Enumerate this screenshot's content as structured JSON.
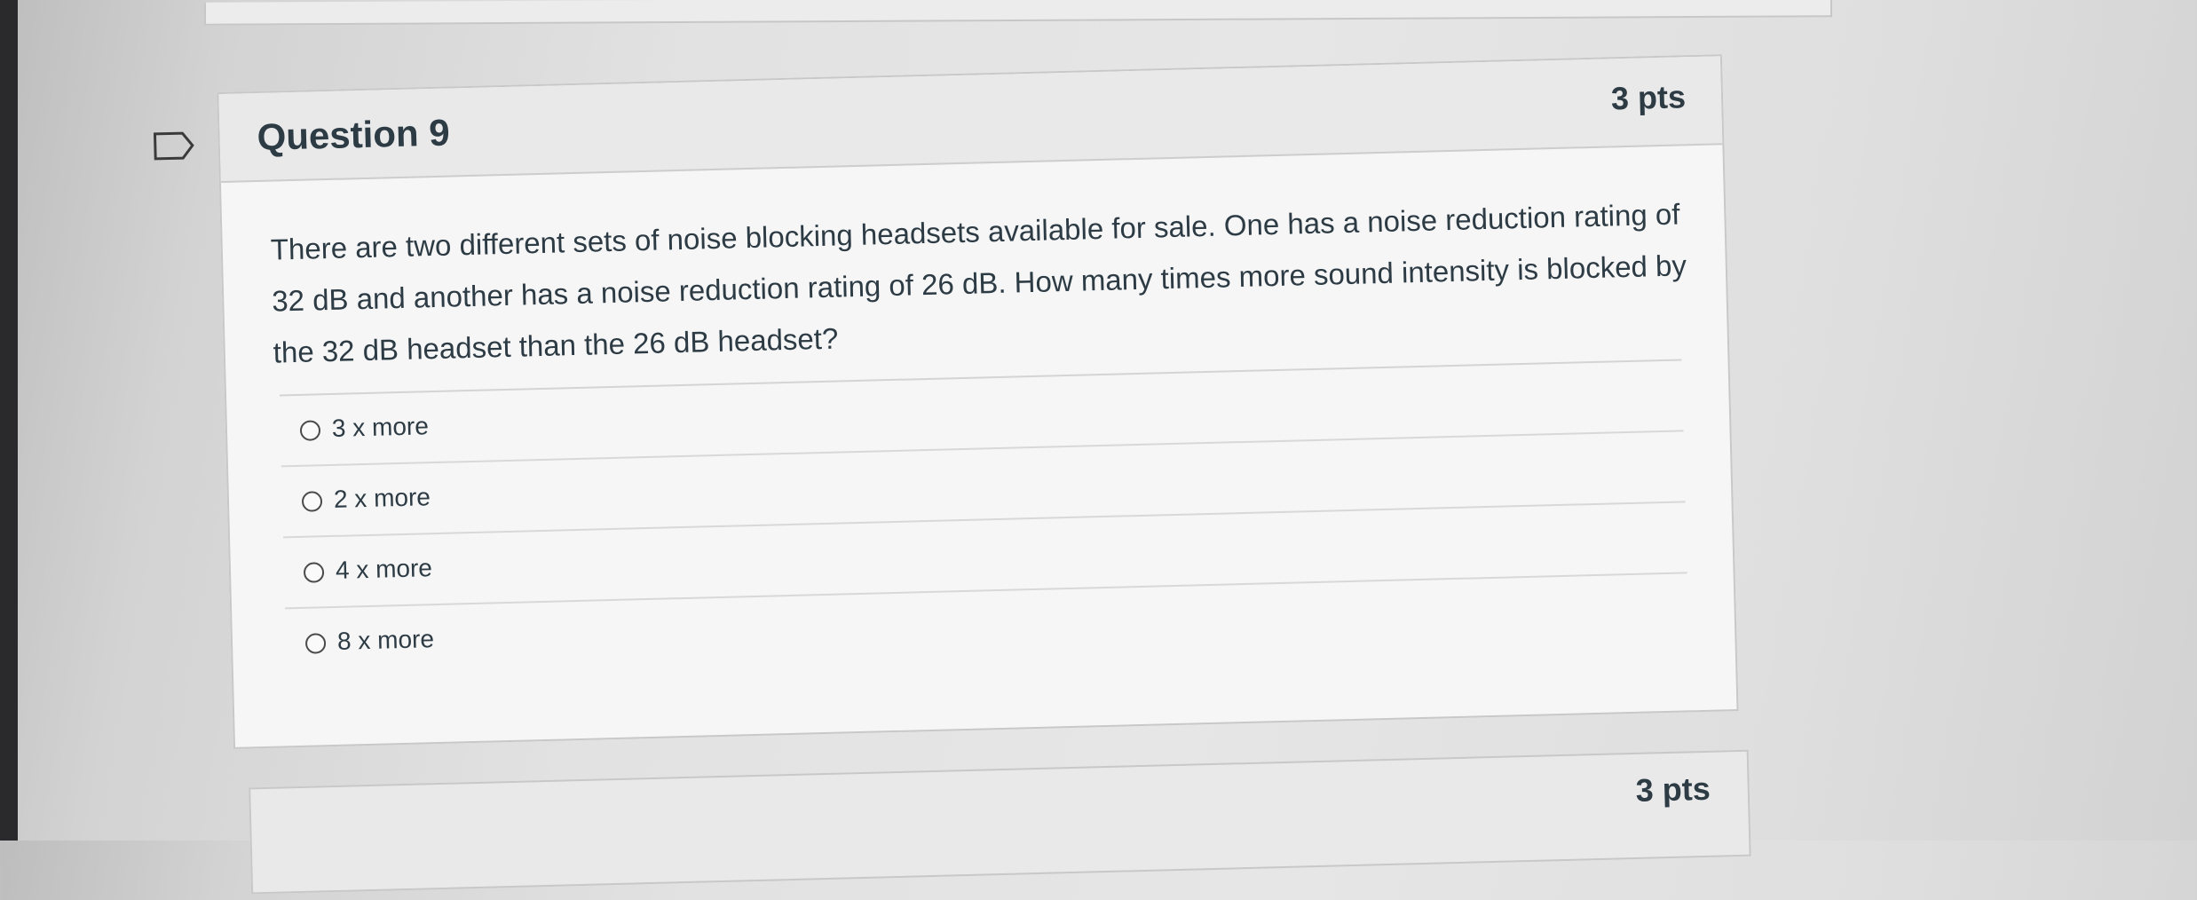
{
  "question": {
    "flag_icon": "flag-outline-icon",
    "title": "Question 9",
    "points": "3 pts",
    "text": "There are two different sets of noise blocking headsets available for sale.  One has a noise reduction rating of 32 dB and another has a noise reduction rating of 26 dB.  How many times more sound intensity is blocked by the 32 dB headset than the 26 dB headset?",
    "answers": [
      {
        "label": "3 x more"
      },
      {
        "label": "2 x more"
      },
      {
        "label": "4 x more"
      },
      {
        "label": "8 x more"
      }
    ]
  },
  "next_question": {
    "points": "3 pts"
  }
}
